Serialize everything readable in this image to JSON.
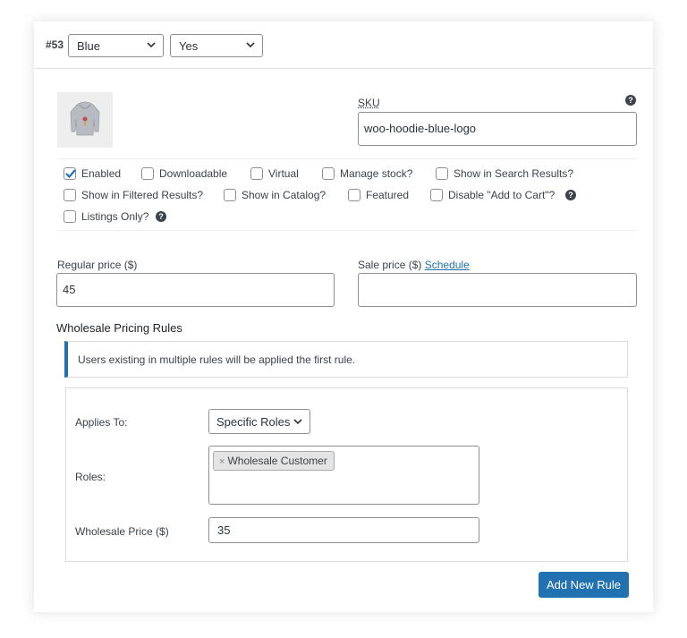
{
  "variation": {
    "number": "#53",
    "attribute_1": "Blue",
    "attribute_2": "Yes"
  },
  "sku": {
    "label": "SKU",
    "value": "woo-hoodie-blue-logo"
  },
  "options": [
    {
      "label": "Enabled",
      "checked": true
    },
    {
      "label": "Downloadable",
      "checked": false
    },
    {
      "label": "Virtual",
      "checked": false
    },
    {
      "label": "Manage stock?",
      "checked": false
    },
    {
      "label": "Show in Search Results?",
      "checked": false
    },
    {
      "label": "Show in Filtered Results?",
      "checked": false
    },
    {
      "label": "Show in Catalog?",
      "checked": false
    },
    {
      "label": "Featured",
      "checked": false
    },
    {
      "label": "Disable \"Add to Cart\"?",
      "checked": false
    },
    {
      "label": "Listings Only?",
      "checked": false
    }
  ],
  "pricing": {
    "regular_label": "Regular price ($)",
    "regular_value": "45",
    "sale_label": "Sale price ($)",
    "schedule_link": "Schedule",
    "sale_value": ""
  },
  "wholesale": {
    "heading": "Wholesale Pricing Rules",
    "notice": "Users existing in multiple rules will be applied the first rule.",
    "applies_label": "Applies To:",
    "applies_value": "Specific Roles",
    "roles_label": "Roles:",
    "role_tag": "Wholesale Customer",
    "price_label": "Wholesale Price ($)",
    "price_value": "35",
    "add_button": "Add New Rule"
  },
  "colors": {
    "accent": "#2271b1",
    "border": "#8c8f94"
  }
}
